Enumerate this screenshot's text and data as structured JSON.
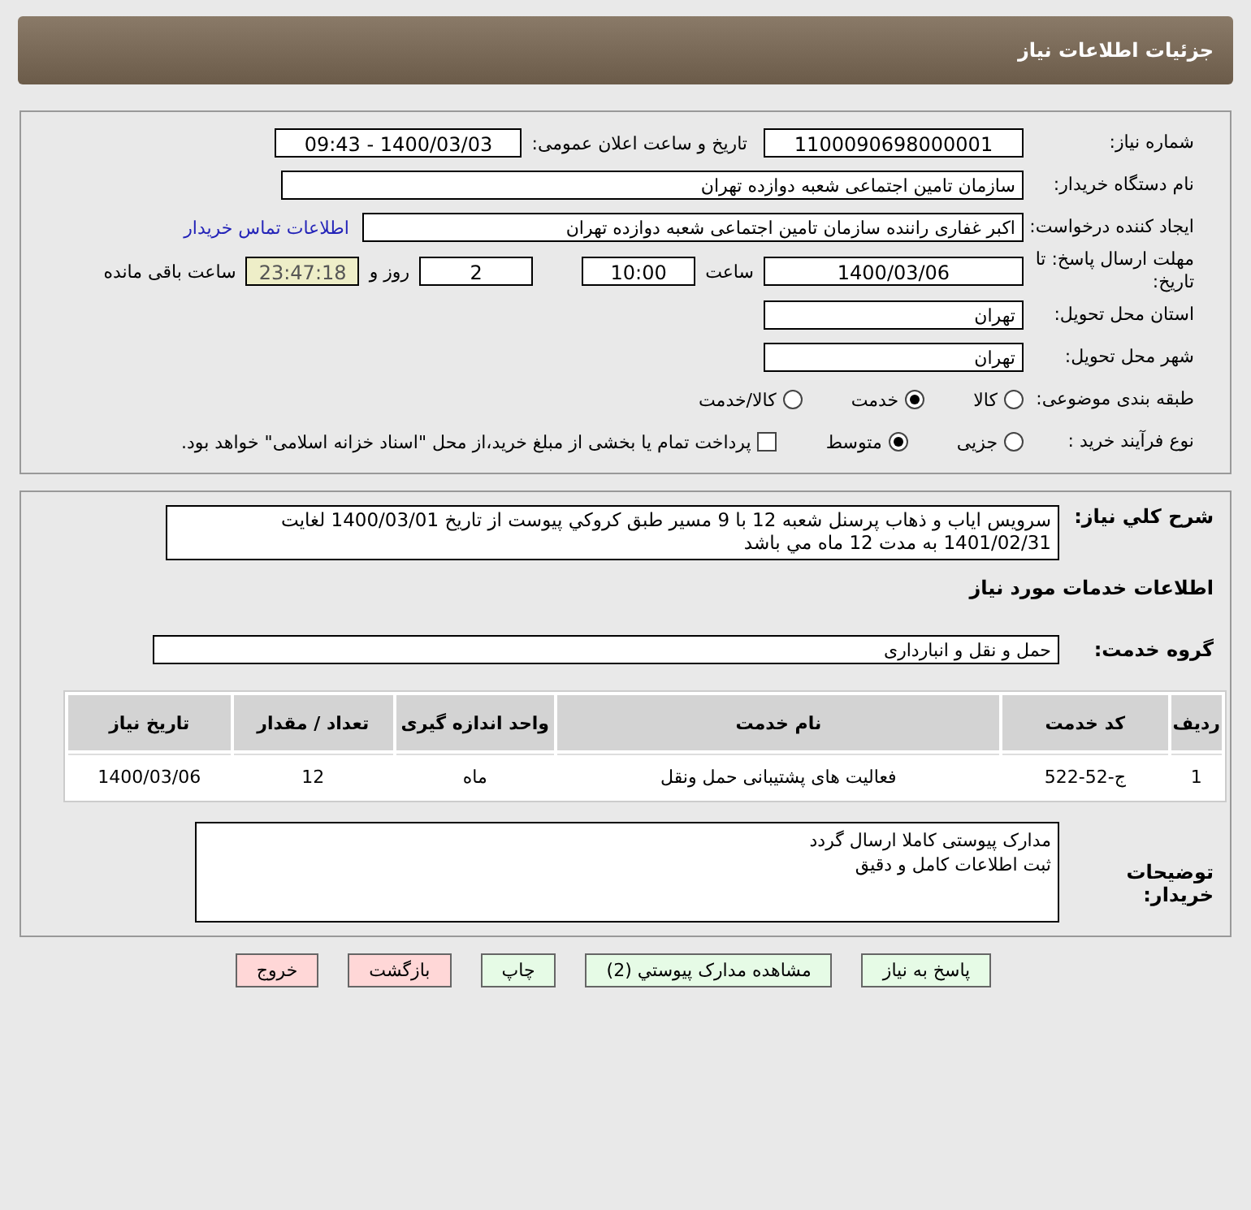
{
  "header": {
    "title": "جزئیات اطلاعات نیاز"
  },
  "details": {
    "need_number": {
      "label": "شماره نیاز:",
      "value": "1100090698000001"
    },
    "announce": {
      "label": "تاریخ و ساعت اعلان عمومی:",
      "value": "1400/03/03 - 09:43"
    },
    "buyer_org": {
      "label": "نام دستگاه خریدار:",
      "value": "سازمان تامین اجتماعی شعبه دوازده تهران"
    },
    "requester": {
      "label": "ایجاد کننده درخواست:",
      "value": "اکبر غفاری راننده سازمان تامین اجتماعی شعبه دوازده تهران",
      "link": "اطلاعات تماس خریدار"
    },
    "deadline": {
      "label": "مهلت ارسال پاسخ: تا تاریخ:",
      "date": "1400/03/06",
      "time_label": "ساعت",
      "time": "10:00",
      "days": "2",
      "days_label": "روز و",
      "remaining": "23:47:18",
      "remaining_label": "ساعت باقی مانده"
    },
    "province": {
      "label": "استان محل تحویل:",
      "value": "تهران"
    },
    "city": {
      "label": "شهر محل تحویل:",
      "value": "تهران"
    },
    "category": {
      "label": "طبقه بندی موضوعی:",
      "options": [
        {
          "label": "کالا",
          "selected": false
        },
        {
          "label": "خدمت",
          "selected": true
        },
        {
          "label": "کالا/خدمت",
          "selected": false
        }
      ]
    },
    "process": {
      "label": "نوع فرآیند خرید :",
      "options": [
        {
          "label": "جزیی",
          "selected": false
        },
        {
          "label": "متوسط",
          "selected": true
        }
      ],
      "payment": {
        "label": "پرداخت تمام یا بخشی از مبلغ خرید،از محل \"اسناد خزانه اسلامی\" خواهد بود.",
        "checked": false
      }
    }
  },
  "description": {
    "label": "شرح کلي نياز:",
    "value": "سرويس اياب و ذهاب پرسنل شعبه 12 با 9 مسير طبق كروكي پيوست از تاريخ 1400/03/01 لغايت 1401/02/31 به مدت 12 ماه مي باشد"
  },
  "services_title": "اطلاعات خدمات مورد نیاز",
  "service_group": {
    "label": "گروه خدمت:",
    "value": "حمل و نقل و انبارداری"
  },
  "table": {
    "columns": [
      "ردیف",
      "کد خدمت",
      "نام خدمت",
      "واحد اندازه گیری",
      "تعداد / مقدار",
      "تاریخ نیاز"
    ],
    "rows": [
      [
        "1",
        "ج-52-522",
        "فعالیت های پشتیبانی حمل ونقل",
        "ماه",
        "12",
        "1400/03/06"
      ]
    ]
  },
  "buyer_notes": {
    "label": "توضیحات خریدار:",
    "lines": [
      "مدارک پیوستی کاملا ارسال گردد",
      "ثبت اطلاعات کامل و دقیق"
    ]
  },
  "buttons": [
    {
      "label": "پاسخ به نیاز",
      "kind": "action"
    },
    {
      "label": "مشاهده مدارک پیوستي (2)",
      "kind": "action"
    },
    {
      "label": "چاپ",
      "kind": "action"
    },
    {
      "label": "بازگشت",
      "kind": "exit"
    },
    {
      "label": "خروج",
      "kind": "exit"
    }
  ]
}
